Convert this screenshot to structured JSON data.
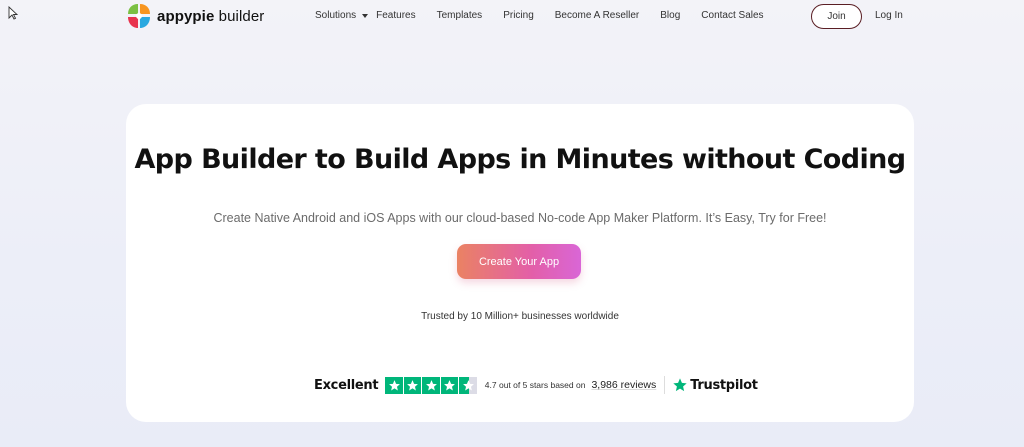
{
  "brand": {
    "name_bold": "appypie",
    "name_rest": " builder",
    "colors": {
      "green": "#7bc043",
      "orange": "#f79520",
      "red": "#e8344e",
      "blue": "#2aa8e0"
    }
  },
  "nav": {
    "items": [
      {
        "label": "Solutions",
        "dropdown": true
      },
      {
        "label": "Features"
      },
      {
        "label": "Templates"
      },
      {
        "label": "Pricing"
      },
      {
        "label": "Become A Reseller"
      },
      {
        "label": "Blog"
      },
      {
        "label": "Contact Sales"
      }
    ],
    "join_label": "Join",
    "login_label": "Log In"
  },
  "hero": {
    "title": "App Builder to Build Apps in Minutes without Coding",
    "subtitle": "Create Native Android and iOS Apps with our cloud-based No-code App Maker Platform. It’s Easy, Try for Free!",
    "cta_label": "Create Your App",
    "trusted_text": "Trusted by 10 Million+ businesses worldwide"
  },
  "trustpilot": {
    "rating_word": "Excellent",
    "stars_rating": 4.5,
    "rating_text": "4.7 out of 5 stars based on",
    "reviews": "3,986 reviews",
    "brand": "Trustpilot",
    "color": "#00b67a"
  }
}
